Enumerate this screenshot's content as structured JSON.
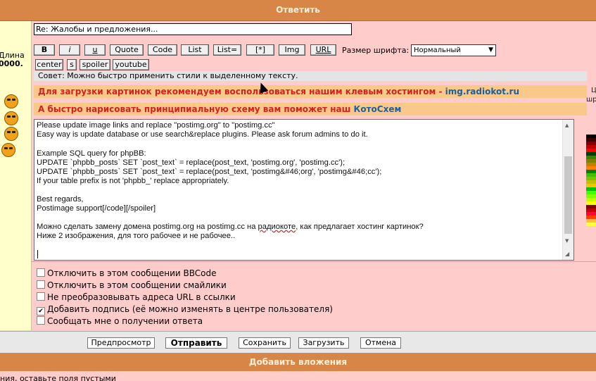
{
  "header": {
    "reply_label": "Ответить"
  },
  "left": {
    "length_label": "Длина",
    "length_value": "0000."
  },
  "subject": {
    "value": "Re: Жалобы и предложения..."
  },
  "toolbar": {
    "buttons": [
      "B",
      "i",
      "u",
      "Quote",
      "Code",
      "List",
      "List=",
      "[*]",
      "Img",
      "URL"
    ],
    "row2": [
      "center",
      "s",
      "spoiler",
      "youtube"
    ],
    "font_size_label": "Размер шрифта:",
    "font_size_value": "Нормальный"
  },
  "tip": "Совет: Можно быстро применить стили к выделенному тексту.",
  "banners": {
    "b1_text": "Для загрузки картинок рекомендуем воспользоваться нашим клевым хостингом - ",
    "b1_link": "img.radiokot.ru",
    "b2_text": "А быстро нарисовать принципиальную схему вам поможет наш ",
    "b2_link": "КотоСхем"
  },
  "right_cut": {
    "l1": "Ц",
    "l2": "шр"
  },
  "message": {
    "line1": "Please update image links and replace \"postimg.org\" to \"postimg.cc\"",
    "line2": "Easy way is update database or use search&replace plugins. Please ask forum admins to do it.",
    "line3": "Example SQL query for phpBB:",
    "line4": "UPDATE `phpbb_posts` SET `post_text` = replace(post_text, 'postimg.org', 'postimg.cc');",
    "line5": "UPDATE `phpbb_posts` SET `post_text` = replace(post_text, 'postimg&#46;org', 'postimg&#46;cc');",
    "line6": "If your table prefix is not 'phpbb_' replace appropriately.",
    "line7": "Best regards,",
    "line8": "Postimage support[/code][/spoiler]",
    "line9a": "Можно сделать замену домена postimg.org на postimg.cc на ",
    "line9b": "радиокоте",
    "line9c": ", как предлагает хостинг картинок?",
    "line10": "Ниже 2 изображения, для того рабочее и не рабочее.."
  },
  "options": [
    {
      "label": "Отключить в этом сообщении BBCode",
      "checked": false
    },
    {
      "label": "Отключить в этом сообщении смайлики",
      "checked": false
    },
    {
      "label": "Не преобразовывать адреса URL в ссылки",
      "checked": false
    },
    {
      "label": "Добавить подпись (её можно изменять в центре пользователя)",
      "checked": true
    },
    {
      "label": "Сообщать мне о получении ответа",
      "checked": false
    }
  ],
  "actions": {
    "preview": "Предпросмотр",
    "submit": "Отправить",
    "save": "Сохранить",
    "load": "Загрузить",
    "cancel": "Отмена"
  },
  "attachments": {
    "label": "Добавить вложения"
  },
  "bottom_text": "ния, оставьте поля пустыми",
  "palette_colors": [
    "#000000",
    "#400000",
    "#800000",
    "#c00000",
    "#ff0000",
    "#004000",
    "#408000",
    "#808000",
    "#c08000",
    "#ff8000",
    "#008000",
    "#40c000",
    "#80c000",
    "#c0c000",
    "#ffc000",
    "#00c000",
    "#40ff00",
    "#80ff00",
    "#c0ff00",
    "#ffff00",
    "#800000",
    "#c00000",
    "#ff0040",
    "#ff4000",
    "#ffc040",
    "#ffff40"
  ]
}
